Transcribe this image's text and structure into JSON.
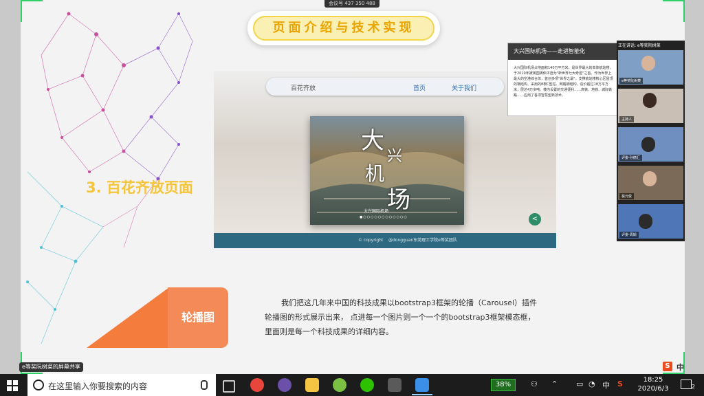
{
  "meeting": {
    "id_label": "会议号 437 350 488",
    "share_bar": "e等奖阮树菜的屏幕共享"
  },
  "slide": {
    "title": "页面介绍与技术实现",
    "section_label": "3. 百花齐放页面",
    "tag_label": "轮播图",
    "paragraph": "我们把这几年来中国的科技成果以bootstrap3框架的轮播（Carousel）插件轮播图的形式展示出来，  点进每一个图片则一个一个的bootstrap3框架模态框，里面则是每一个科技成果的详细内容。",
    "shot": {
      "nav_brand": "百花齐放",
      "nav_home": "首页",
      "nav_about": "关于我们",
      "carousel_text1": "大",
      "carousel_text2": "兴",
      "carousel_text3": "机",
      "carousel_text4": "场",
      "carousel_caption": "大兴国际机场",
      "footer_copyright": "© copyright",
      "footer_credit": "@dongguan东莞理工学院e等奖团队"
    },
    "info_card": {
      "title": "大兴国际机场——走进智能化",
      "body": "大兴国际机场占地面积140万平方米，是世界最大的单体航站楼，于2019年被英国媒体评选为\"新世界七大奇迹\"之首。作为世界上最大的空港综合体，首创多项\"世界之最\"。支撑航站楼核心区屋顶的钢结构、采用的8根C型柱、网格钢结构，造价超过18万平方米，层达4万多吨。楼内设置的交通便利……高铁、地铁、城际铁路……应用了各项智慧型新技术。"
    }
  },
  "participants": {
    "header": "正在讲话: e等奖阮树菜",
    "tiles": [
      {
        "label": "e等奖阮树菜",
        "color": "#7fa0c4"
      },
      {
        "label": "主持人",
        "color": "#c9bfb4"
      },
      {
        "label": "评委-孙德汇",
        "color": "#6f8fc0"
      },
      {
        "label": "裴元俊",
        "color": "#7b6a58"
      },
      {
        "label": "评委-周娟",
        "color": "#4f76b7"
      }
    ]
  },
  "taskbar": {
    "search_placeholder": "在这里输入你要搜索的内容",
    "battery": "38%",
    "ime_lang": "中",
    "time": "18:25",
    "date": "2020/6/3",
    "notif_count": "2"
  },
  "ime": {
    "label": "中"
  },
  "colors": {
    "accent": "#f47d3e",
    "title_gold": "#e9a400",
    "section_gold": "#f4c43a",
    "footer": "#2d6a82"
  }
}
